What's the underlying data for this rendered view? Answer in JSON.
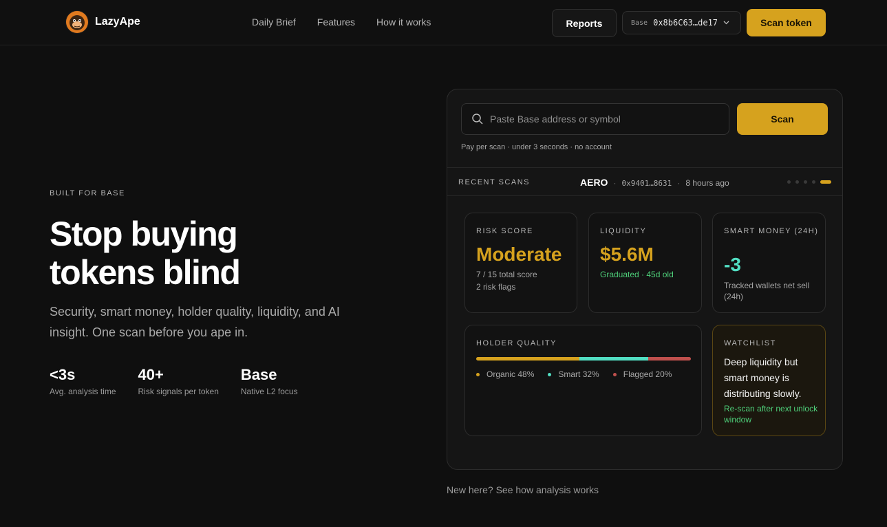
{
  "brand": {
    "name": "LazyApe"
  },
  "nav": {
    "links": [
      "Daily Brief",
      "Features",
      "How it works"
    ],
    "reports_label": "Reports",
    "wallet": {
      "chain": "Base",
      "address": "0x8b6C63…de17"
    },
    "scan_token_label": "Scan token"
  },
  "hero": {
    "eyebrow": "BUILT FOR BASE",
    "headline_line1": "Stop buying",
    "headline_line2": "tokens blind",
    "subtext": "Security, smart money, holder quality, liquidity, and AI insight. One scan before you ape in.",
    "stats": [
      {
        "value": "<3s",
        "label": "Avg. analysis time"
      },
      {
        "value": "40+",
        "label": "Risk signals per token"
      },
      {
        "value": "Base",
        "label": "Native L2 focus"
      }
    ]
  },
  "panel": {
    "search": {
      "placeholder": "Paste Base address or symbol",
      "value": ""
    },
    "scan_label": "Scan",
    "scan_note": "Pay per scan · under 3 seconds · no account",
    "recent": {
      "label": "RECENT SCANS",
      "symbol": "AERO",
      "address": "0x9401…8631",
      "time": "8 hours ago",
      "total_pages": 5,
      "active_page": 5
    },
    "risk": {
      "label": "RISK SCORE",
      "value": "Moderate",
      "line1": "7 / 15 total score",
      "line2": "2 risk flags"
    },
    "liquidity": {
      "label": "LIQUIDITY",
      "value": "$5.6M",
      "line1": "Graduated · 45d old"
    },
    "smart_money": {
      "label": "SMART MONEY (24H)",
      "value": "-3",
      "line1": "Tracked wallets net sell (24h)"
    },
    "holder_quality": {
      "label": "HOLDER QUALITY",
      "segments": [
        {
          "name": "Organic",
          "percent": 48,
          "text": "Organic 48%",
          "color": "#d6a21e"
        },
        {
          "name": "Smart",
          "percent": 32,
          "text": "Smart 32%",
          "color": "#52dfc3"
        },
        {
          "name": "Flagged",
          "percent": 20,
          "text": "Flagged 20%",
          "color": "#c0504d"
        }
      ]
    },
    "watchlist": {
      "label": "WATCHLIST",
      "body": "Deep liquidity but smart money is distributing slowly.",
      "note": "Re-scan after next unlock window"
    }
  },
  "footer": {
    "link": "New here? See how analysis works"
  },
  "colors": {
    "accent": "#d6a21e",
    "positive": "#4ed07a",
    "teal": "#52dfc3",
    "negative": "#c0504d",
    "background": "#0f0f0f"
  }
}
